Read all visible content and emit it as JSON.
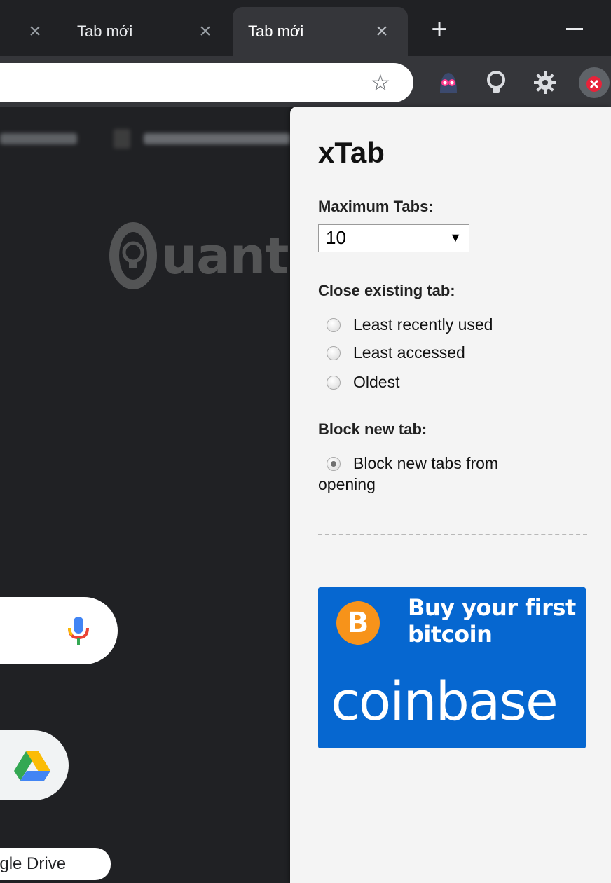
{
  "tabs": [
    {
      "title": "",
      "close": "×"
    },
    {
      "title": "Tab mới",
      "close": "×"
    },
    {
      "title": "Tab mới",
      "close": "×",
      "active": true
    }
  ],
  "tab_actions": {
    "new_tab": "+"
  },
  "toolbar": {
    "star": "☆",
    "extensions": [
      "ghost-extension-icon",
      "lightbulb-extension-icon",
      "gear-extension-icon",
      "xtab-extension-icon"
    ]
  },
  "page": {
    "watermark": "uantrimang",
    "shortcut_label": "ogle Drive"
  },
  "popup": {
    "title": "xTab",
    "max_tabs_label": "Maximum Tabs:",
    "max_tabs_value": "10",
    "close_existing_label": "Close existing tab:",
    "close_options": [
      {
        "label": "Least recently used",
        "checked": false
      },
      {
        "label": "Least accessed",
        "checked": false
      },
      {
        "label": "Oldest",
        "checked": false
      }
    ],
    "block_label": "Block new tab:",
    "block_option": {
      "label_line1": "Block new tabs from",
      "label_line2": "opening",
      "checked": true
    },
    "ad": {
      "headline_line1": "Buy your first",
      "headline_line2": "bitcoin",
      "brand": "coinbase",
      "bitcoin_symbol": "B",
      "background_color": "#0667d0",
      "badge_color": "#f7931a"
    }
  }
}
